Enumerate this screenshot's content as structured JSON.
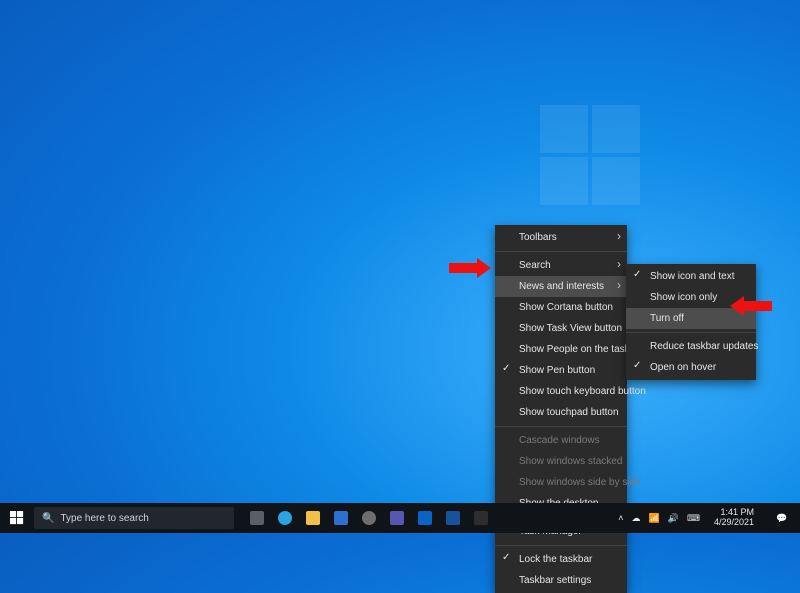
{
  "search": {
    "placeholder": "Type here to search"
  },
  "menu1": {
    "items": [
      {
        "label": "Toolbars",
        "sub": true
      },
      {
        "sep": true
      },
      {
        "label": "Search",
        "sub": true
      },
      {
        "label": "News and interests",
        "sub": true,
        "hl": true
      },
      {
        "label": "Show Cortana button"
      },
      {
        "label": "Show Task View button"
      },
      {
        "label": "Show People on the taskbar"
      },
      {
        "label": "Show Pen button",
        "chk": true
      },
      {
        "label": "Show touch keyboard button"
      },
      {
        "label": "Show touchpad button"
      },
      {
        "sep": true
      },
      {
        "label": "Cascade windows",
        "dis": true
      },
      {
        "label": "Show windows stacked",
        "dis": true
      },
      {
        "label": "Show windows side by side",
        "dis": true
      },
      {
        "label": "Show the desktop"
      },
      {
        "sep": true
      },
      {
        "label": "Task Manager"
      },
      {
        "sep": true
      },
      {
        "label": "Lock the taskbar",
        "chk": true
      },
      {
        "label": "Taskbar settings"
      }
    ]
  },
  "menu2": {
    "items": [
      {
        "label": "Show icon and text",
        "chk": true
      },
      {
        "label": "Show icon only"
      },
      {
        "label": "Turn off",
        "hl": true
      },
      {
        "sep": true
      },
      {
        "label": "Reduce taskbar updates"
      },
      {
        "label": "Open on hover",
        "chk": true
      }
    ]
  },
  "clock": {
    "time": "1:41 PM",
    "date": "4/29/2021"
  },
  "taskbar_icons": [
    "task-view",
    "edge",
    "explorer",
    "store",
    "settings",
    "teams",
    "mail",
    "word",
    "terminal"
  ]
}
